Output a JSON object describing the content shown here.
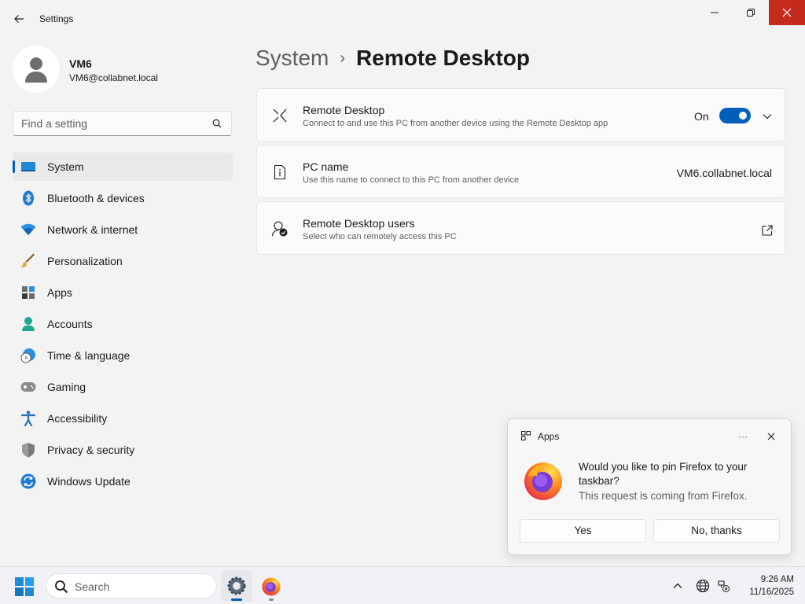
{
  "window": {
    "title": "Settings"
  },
  "profile": {
    "name": "VM6",
    "email": "VM6@collabnet.local"
  },
  "search": {
    "placeholder": "Find a setting"
  },
  "nav": {
    "items": [
      {
        "label": "System",
        "icon": "system-icon",
        "active": true
      },
      {
        "label": "Bluetooth & devices",
        "icon": "bluetooth-icon"
      },
      {
        "label": "Network & internet",
        "icon": "wifi-icon"
      },
      {
        "label": "Personalization",
        "icon": "brush-icon"
      },
      {
        "label": "Apps",
        "icon": "apps-icon"
      },
      {
        "label": "Accounts",
        "icon": "accounts-icon"
      },
      {
        "label": "Time & language",
        "icon": "clock-globe-icon"
      },
      {
        "label": "Gaming",
        "icon": "gamepad-icon"
      },
      {
        "label": "Accessibility",
        "icon": "accessibility-icon"
      },
      {
        "label": "Privacy & security",
        "icon": "shield-icon"
      },
      {
        "label": "Windows Update",
        "icon": "update-icon"
      }
    ]
  },
  "header": {
    "parent": "System",
    "separator": "›",
    "current": "Remote Desktop"
  },
  "cards": {
    "remote_desktop": {
      "title": "Remote Desktop",
      "subtitle": "Connect to and use this PC from another device using the Remote Desktop app",
      "toggle_label": "On",
      "toggle_on": true
    },
    "pc_name": {
      "title": "PC name",
      "subtitle": "Use this name to connect to this PC from another device",
      "value": "VM6.collabnet.local"
    },
    "users": {
      "title": "Remote Desktop users",
      "subtitle": "Select who can remotely access this PC"
    }
  },
  "toast": {
    "app": "Apps",
    "more": "···",
    "message": "Would you like to pin Firefox to your taskbar?",
    "source": "This request is coming from Firefox.",
    "yes_label": "Yes",
    "no_label": "No, thanks"
  },
  "taskbar": {
    "search_label": "Search",
    "time": "9:26 AM",
    "date": "11/16/2025"
  },
  "colors": {
    "accent": "#005fb8",
    "close": "#c42b1c",
    "background": "#f3f3f3"
  }
}
